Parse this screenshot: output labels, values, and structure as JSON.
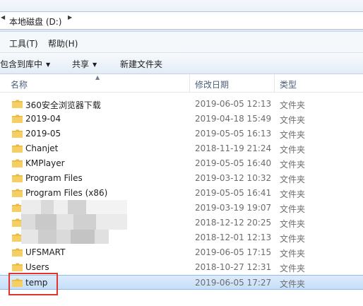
{
  "address_bar": {
    "path_label": "本地磁盘 (D:)"
  },
  "menu": {
    "tools": "工具(T)",
    "help": "帮助(H)"
  },
  "toolbar": {
    "include_in_library": "包含到库中",
    "share": "共享",
    "new_folder": "新建文件夹"
  },
  "columns": {
    "name": "名称",
    "modified": "修改日期",
    "type": "类型"
  },
  "files": [
    {
      "name": "360安全浏览器下载",
      "modified": "2019-06-05 12:13",
      "type": "文件夹"
    },
    {
      "name": "2019-04",
      "modified": "2019-04-18 15:49",
      "type": "文件夹"
    },
    {
      "name": "2019-05",
      "modified": "2019-05-05 16:13",
      "type": "文件夹"
    },
    {
      "name": "Chanjet",
      "modified": "2018-11-19 21:24",
      "type": "文件夹"
    },
    {
      "name": "KMPlayer",
      "modified": "2019-05-05 16:40",
      "type": "文件夹"
    },
    {
      "name": "Program Files",
      "modified": "2019-03-12 10:32",
      "type": "文件夹"
    },
    {
      "name": "Program Files (x86)",
      "modified": "2019-05-05 16:41",
      "type": "文件夹"
    },
    {
      "name": "",
      "modified": "2019-03-19 19:07",
      "type": "文件夹"
    },
    {
      "name": "",
      "modified": "2018-12-12 20:25",
      "type": "文件夹"
    },
    {
      "name": "",
      "modified": "2018-12-01 12:13",
      "type": "文件夹"
    },
    {
      "name": "UFSMART",
      "modified": "2019-06-05 17:15",
      "type": "文件夹"
    },
    {
      "name": "Users",
      "modified": "2018-10-27 12:31",
      "type": "文件夹"
    },
    {
      "name": "temp",
      "modified": "2019-06-05 17:27",
      "type": "文件夹",
      "selected": true
    }
  ],
  "colors": {
    "selection": "#cce4fb",
    "highlight_box": "#e0352c",
    "folder": "#e8b93e"
  }
}
